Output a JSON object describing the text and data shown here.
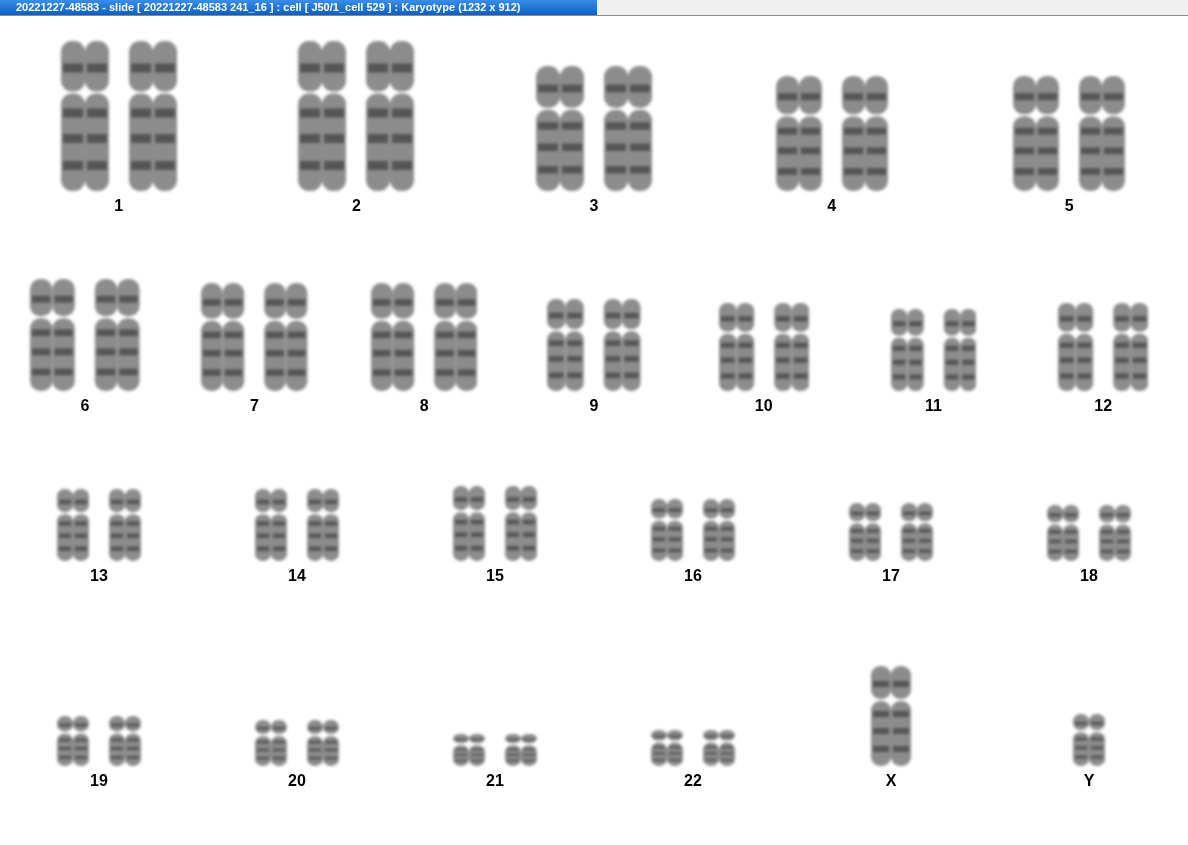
{
  "window": {
    "title": "20221227-48583 - slide [ 20221227-48583 241_16 ] : cell [ J50/1_cell 529 ] : Karyotype  (1232 x 912)"
  },
  "karyotype": {
    "rows": [
      {
        "items": [
          {
            "label": "1",
            "kind": "pair"
          },
          {
            "label": "2",
            "kind": "pair"
          },
          {
            "label": "3",
            "kind": "pair"
          },
          {
            "label": "4",
            "kind": "pair"
          },
          {
            "label": "5",
            "kind": "pair"
          }
        ]
      },
      {
        "items": [
          {
            "label": "6",
            "kind": "pair"
          },
          {
            "label": "7",
            "kind": "pair"
          },
          {
            "label": "8",
            "kind": "pair"
          },
          {
            "label": "9",
            "kind": "pair"
          },
          {
            "label": "10",
            "kind": "pair"
          },
          {
            "label": "11",
            "kind": "pair"
          },
          {
            "label": "12",
            "kind": "pair"
          }
        ]
      },
      {
        "items": [
          {
            "label": "13",
            "kind": "pair"
          },
          {
            "label": "14",
            "kind": "pair"
          },
          {
            "label": "15",
            "kind": "pair"
          },
          {
            "label": "16",
            "kind": "pair"
          },
          {
            "label": "17",
            "kind": "pair"
          },
          {
            "label": "18",
            "kind": "pair"
          }
        ]
      },
      {
        "items": [
          {
            "label": "19",
            "kind": "pair"
          },
          {
            "label": "20",
            "kind": "pair"
          },
          {
            "label": "21",
            "kind": "pair"
          },
          {
            "label": "22",
            "kind": "pair"
          },
          {
            "label": "X",
            "kind": "single"
          },
          {
            "label": "Y",
            "kind": "single"
          }
        ]
      }
    ]
  }
}
